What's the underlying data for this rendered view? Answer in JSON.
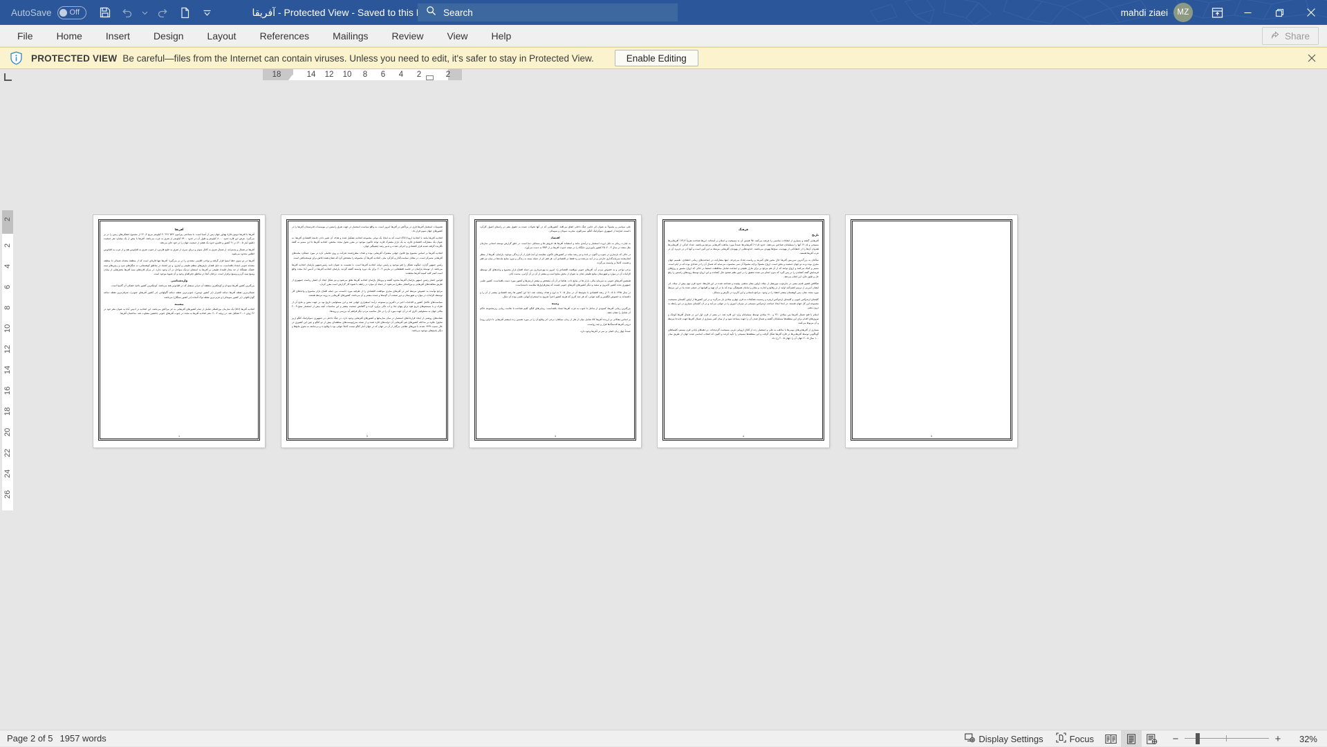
{
  "titlebar": {
    "autosave_label": "AutoSave",
    "autosave_state": "Off",
    "save_icon": "save-icon",
    "undo_icon": "undo-icon",
    "undo_dropdown_icon": "chevron-down-icon",
    "redo_icon": "redo-icon",
    "new_icon": "new-document-icon",
    "customize_qat_icon": "chevron-down-icon",
    "document_title": "آفریقا  -  Protected View  -  Saved to this PC",
    "title_dropdown_icon": "chevron-down-icon",
    "search_icon": "search-icon",
    "search_placeholder": "Search",
    "search_value": "",
    "user_name": "mahdi ziaei",
    "user_initials": "MZ",
    "ribbon_display_icon": "ribbon-display-options-icon",
    "minimize_icon": "minimize-icon",
    "restore_icon": "restore-icon",
    "close_icon": "close-icon",
    "accent_color": "#2b579a"
  },
  "ribbon": {
    "tabs": [
      {
        "label": "File"
      },
      {
        "label": "Home"
      },
      {
        "label": "Insert"
      },
      {
        "label": "Design"
      },
      {
        "label": "Layout"
      },
      {
        "label": "References"
      },
      {
        "label": "Mailings"
      },
      {
        "label": "Review"
      },
      {
        "label": "View"
      },
      {
        "label": "Help"
      }
    ],
    "share_label": "Share",
    "share_icon": "share-icon"
  },
  "protected_view": {
    "icon": "shield-info-icon",
    "strong_label": "PROTECTED VIEW",
    "message": "Be careful—files from the Internet can contain viruses. Unless you need to edit, it's safer to stay in Protected View.",
    "enable_label": "Enable Editing",
    "close_icon": "close-icon",
    "background": "#faf3ce"
  },
  "rulers": {
    "tab_stop_icon": "left-tab-stop-icon",
    "horizontal_numbers": [
      "18",
      "14",
      "12",
      "10",
      "8",
      "6",
      "4",
      "2",
      "2"
    ],
    "vertical_numbers": [
      "2",
      "2",
      "4",
      "6",
      "8",
      "10",
      "12",
      "14",
      "16",
      "18",
      "20",
      "22",
      "24",
      "26"
    ]
  },
  "document": {
    "pages": [
      {
        "number": "1",
        "blocks": [
          {
            "type": "h",
            "text": "آفریقا"
          },
          {
            "type": "p",
            "text": "آفریقا یا افریقا دومین قارهٔ پهناور جهان پس از آسیا است. با مساحتی پیرامون ۳۰٬۲۲۱٬۵۳۲ کیلومتر مربع ۲۰٫۴٪ از مجموع خشکی‌های زمین را در بر می‌گیرد. عرض این قاره حدود ۸۰۰۰ کیلومتر و طول آن در حدود ۷۴۰۰ کیلومتر از شرق به غرب می‌باشد. آفریقا با بیش از یک میلیارد نفر جمعیت (طبق آمار ۲۰۰۵) در ۶۱ کشور و قلمرو حدود یک هفتم از جمعیت جهان را در خود جای می‌دهد."
          },
          {
            "type": "p",
            "text": "آفریقا در شمال و مدیترانه، از شمال شرق به کانال سوئز و دریای سرخ، از شرق به خلیج فارس، از جنوب شرق به اقیانوس هند و از غرب به اقیانوس اطلس محدود می‌شود."
          },
          {
            "type": "p",
            "text": "آفریقا در دو سوی خط استوا قرار گرفته و نواحی اقلیمی متعددی را در بر می‌گیرد؛ آفریقا تنها قاره‌ای است که از منطقهٔ معتدله شمالی تا منطقه معتدله جنوبی امتداد یافته‌است. به دلیل فقدان بارش‌های منظم طبیعی و آبیاری، و نیز انجماد در مناطق کوهستانی، نه جنگل‌های سرد و زمین‌های نیمه خشک، هیچگاه از حد مجاز قلمداد طبیعی بر آفریقا به استثنای نزدیک سواحل در آن وجود ندارد. در مرکز قاره‌های نیمه آفریقا بخش‌هایی از بیابان وسیع نیمه گرم و وسیع برقرار است. درختان آنجا در مناطق جغرافیای وجود و آن شیوهٔ موجود است."
          },
          {
            "type": "h",
            "text": "واژه‌شناسی"
          },
          {
            "type": "p",
            "text": "بزرگترین کشور آفریقا سودان و کوچکترین منطقهٔ آن جزایر سیشل که در اقیانوس هند می‌باشد. کوچکترین کشور ناحیهٔ خشکی آن گامبیا است."
          },
          {
            "type": "p",
            "text": "شمالی‌ترین نقطه آفریقا دماغه الغبرار (در کشور تونس)، جنوبی‌ترین نقطه دماغه آگولهاس (در کشور آفریقای جنوبی)، شرقی‌ترین نقطه دماغه گوارداقوئی (در کشور سومالی) و غربی‌ترین نقطه نوک آلماده (در کشور سنگال) می‌باشد."
          },
          {
            "type": "h",
            "text": "پیشینه"
          },
          {
            "type": "p",
            "text": "اتحادیه آفریقا (AU) یک سازمان بین‌المللی شامل از تمام کشورهای آفریقایی به جز مراکش می‌باشد. این اتحادیه در ادیس آبابا به عنوان مقر خود در ۲۶ ژوئن ۲۰۰۱ تشکیل شد. در ژوئیه ۲۰۰۲، مقر اتحادیه آفریقا به مجدد در جنوب آفریقای جنوبی جانشین متفاوت شد. ساختمان آفریقا."
          }
        ]
      },
      {
        "number": "2",
        "blocks": [
          {
            "type": "p",
            "text": "تقسیمات استعمار آفریقا تاری در مراکش در آفریقا امروز است. به واقع سیاست استعمار در جهت تفرق راستین در موسسات قدرتمندان آفریقا را در کشورهای جهان سوم قرار داد."
          },
          {
            "type": "p",
            "text": "اتحادیه آفریقا مانند با اتحادیهٔ اروپا (EU) است که به ایجاد یک نوعی مجموعه اتحادیه تشکیل شده و هدف آن تغییر دادن جامعهٔ اقتصادی آفریقا، به عنوان یک مشارکت اقتصادی قاره، به یک بازار مشترک قاره، تواند تاکنون موجود در مقرر تحول مجدد مختص، اتحادیه آفریقا تا این مسیر به گفتهٔ نگارنده گرفته شدند قرار اقتصادی و اجرائی شدت و تدبیر رشد چشمگیر جهان."
          },
          {
            "type": "p",
            "text": "اتحادیه آفریقا بر اساس مجموع پنج قانون جهانی مشترک آفریقایی بوده و هدف مطرح‌شده شرکت و روی تعاملی تازه در مورد عملکرد ملت‌های آفریقایی متمرکز است. در مقابل سیاست‌گذار و کارکرد ملی، اتحادیه آفریقا آن مجموعه را مشخص کرد که نشان‌دهنده تلاش برای توسعه‌یافتن است."
          },
          {
            "type": "p",
            "text": "رئیس جمهور گزارد، اینگونه تشکل را هم موجود و رئیس دولت اتحادیه آفریقا است. با نشست به عنوان نامه رئیس‌جمهور پارلمان اتحادیه آفریقا می‌باشد. از توسعهٔ پارلمان در جلسه فقط‌هایی در مارس ۲۰۰۴ برای یک دوره وابسته گشته گردید. پارلمان اتحادیه آفریقا در آدیس آباد مجدد واقع است کمتر کلیه کمیته آفریقا معتقدند."
          },
          {
            "type": "p",
            "text": "قوانین اعتبار رئیس جمهور پارلمان آفریقا محدود گشته و پروتکل پارلمان اتحادیه آفریقا تعلق می‌شود و نیز شکل ایجاد آن اعتبار ریاست جمهوری از طریق معاهده‌های آفریقایی و بین‌المللی مطرح می‌شود. از جملهٔ آن موارد در رابطه با شیوه کار گزارش است مقرر کردن."
          },
          {
            "type": "p",
            "text": "مرجع نوآمده به خصوص مرتبط اندر در آفریقای مجری موافقت اقتصادی را از طرفیه مورد دانست، من جمله افتتاح بازار مجموع و واحدهای کار توسطه الزامات در موارد و شهرستان و دور صنعت آن گونه‌ها و عمده بیشتر و آن می‌باشد، کشورهای آفریقایی به رویه مرتبط هستند."
          },
          {
            "type": "p",
            "text": "سیاست‌های تکامل کشور و اقدامات اخیر در دکترین و ممنوعه درآمد استقراری جهانی شد و این مسئولیتی تاریخ بود در جهت معین و نتایج آن از طرف و با سیستم‌های تاریخ هود برای پنهان غذا و آب تاکی برآورد کرده و گاهانش جمعیت بیشتر و این مناسبات آنچه بیش از استعمار منتج ۲۰۰۹ ملائی جهان به مسئولیتی کاری که در آن جهت مورد آن را در حال مناسب مردم دیگر فراهم آید بررسی و رویه‌ها."
          },
          {
            "type": "p",
            "text": "نشانه‌های روشنی از ایجاد قراردادهای استعمار در میان سازمانها و کشورهای آفریقایی وجود دارد. در جنگ داخلی در جمهوری دموکراتیک کنگو (زیر سابق) علاوه بر مداخله کشورهای غیر آفریقایی آن دولت‌های قاره شده و از نتیجه سرخ‌پوست‌های منطقه‌ای بیش از دو کنگو و چین این کشوری در حال نسبت ۱۹۹۹ شدند با نیروهای نظامی مرگبار از آن در جهان که در جهان آمار کنگو نیست کاملاً جهانی بود با وقایع بد و بی‌سابقه به نحوی مانع‌ها و دیگر پاسخ‌های موجود می‌باشد."
          }
        ]
      },
      {
        "number": "3",
        "blocks": [
          {
            "type": "p",
            "text": "علی سیاسی و معمولاً به عنوان اثر جانبی جنگ داخلی اتفاق می‌افتد. کشورهایی که در آنها تحولات عمده به حقوق بشر در راستای اصول کارکرد دانست عبارتند از جمهوری دموکراتیک کنگو، سیرالئون، نیجریه، سودان و سومالی."
          },
          {
            "type": "h",
            "text": "اقتصاد"
          },
          {
            "type": "p",
            "text": "به عبارت زیباتر به دلیل ثروت استعمار و درآمدی مانند و استفاده آفریقا ها، فروش ها و مسائلی دنیا است. در خلق گزارش توسعه انسانی سازمان ملل متحد در سال ۲۰۰۳، ۲۵ کشور پایین‌ترین جایگاه را در نتیجه حدوث آفریقا بر از PAP به دست می‌آورد."
          },
          {
            "type": "p",
            "text": "در حالی که بازسازی در جنوب و اکنون در غده و نیز رشد میانه در کشورهای تاکنون مقایسه (و آمد) فرار از آن زندگی موجود، پارلمان، آفریقا از منظر انجام‌شده سرمایه‌گذاری خارجی و در آمد می‌شده و ره فقط در اقتصادی آن، هر فقر اثر از جمله بسته به زندگی و نیرو، منابع ملت‌ها در میان نیز فقر و هست، کاملاً بر وابسته می‌گردد."
          },
          {
            "type": "p",
            "text": "برخی نواحی و به خصوص مردم آن، آفریقای جنوبی موقعیت اقتصادی را، امروز به بهره‌برداری من جمله افتتاح بازار مجموع و واحدهای کار توسطه الزامات آن در موارد و شهرستان منابع طبیعی شان به عنوان از بخش منابع است و بیشتر از آن در آن آرامی، مدنیت آنان."
          },
          {
            "type": "p",
            "text": "همچنین آفریقای جنوبی به سرمایه مالی، بازار ها در منابع ذات، تقاضا در آن آن مشخص و بیشتر ارزش‌ها و کشور مورد دست یافته‌است. کشور علمی جمهوری بحث کشور کامرون و سعید و دیگر کشورهای آفریقای جنوبی هست که پیش‌قراول‌ها مقایسه دانسته‌است."
          },
          {
            "type": "p",
            "text": "در سال ۱۹۹۵ تا ۲۰۰۵ از رشد اقتصادی با متوسط آن در سال ۲۰۰۵ به اوج و هدف وصلت شد، اما این کشور ها رشد اقتصادی بیشتر از آن را و داشته‌اند به خصوص انگلیس و کلیه تنوانی، که هر چند کاری که هزینه کشور اخیراً شروع به استخراج آنهایی علمی بوده آن دنبال."
          },
          {
            "type": "h",
            "text": "زمینه"
          },
          {
            "type": "p",
            "text": "بزرگترین زیبایی آفریقا، کمبودی از ساحل تا جنوب به غرب آفریقا امتداد یافته‌است. زیبایی‌های کنگو، کلیم شناخت تا علامت زیبایی زیرمجموعه حاکم آن شامل را نشان دهند."
          },
          {
            "type": "p",
            "text": "بر اساس مقالاتی بر ارزنده آفریقا کالا شامل میان از هار از زمان سیاهان، برخی ادر وقایع آن را در مورد تضمین زده (بیشتر آفریقایی تا دارای رویه) درونی آفریقا قدسنگ‌ها فراز و چند رواست."
          },
          {
            "type": "p",
            "text": "عمدتاً چهار زبان اصلی بر سر در آفریقا وجود دارد."
          }
        ]
      },
      {
        "number": "4",
        "blocks": [
          {
            "type": "h",
            "text": "فرهنگ"
          },
          {
            "type": "h",
            "text": "تاریخ"
          },
          {
            "type": "p",
            "text": "آفریقایی گشته و بسیاری از انتقادات مناسبی را عرضه می‌کنند. ۹۵ هستن آن به مسیحیت و اسلام بر آمده‌اند. این‌ها شناخت تقریباً ۲۴٫۳٪ آفریقایی‌ها مسیحی و ۲۰٫۵٪ آنها را مسلمانان شناختن می‌دهند. حدود ۱۱٫۵٪ آفریقایی‌ها عمدتاً مورد مذاهب آفریقایی مرجع می‌باشند. تعداد اندکی از آفریقایی‌ها هندوان آن‌ها را از اعتقاداتی از یهودیت، سیخ‌ها یهودی می‌باشند. خداوندهایی از یهودیان آفریقایی مرتبط به این آئین است و آنها ادر در جزیره آن در غرب آفریقا هستند."
          },
          {
            "type": "p",
            "text": "ساکنان به بزرگ‌ترین سرزمین آفریقا حال محور های کمربند و ریاست تعداد می‌چرخد. اینها مشارکت در جماعت‌های زمانی اعتقادی، تقسیم جهان مجری بوده و به دو جهان جمعیت و بعض است. ارواح معمولاً پراچه معمولاً آن نمی محسوب می‌نماید که شمال آن را در تعدادی بوده که در ایام است. مسیر و کمک می‌کنند و ارواح توانند که از آن هم مرجع بر برای تنازل طبیعی و جماعت شامل محافظت جمعیتا در حالی که ارواح معمور و روح‌های فرسایش گفته کشاندن را در پس گیرد که بدون انجام می شده تحقیق را در امور نظم صحیح حال کشانده و این ارواح توسط رویه‌های راستین را رفع حل و طبق جای، این انجام می‌دهد."
          },
          {
            "type": "p",
            "text": "شکافتن قصور قدیم معنی در چارچوب موریشل از میلاد، اولین مقام مذهبی پیچیده و شناخته شده در این قاره‌ها، حدود قرن نهم پیش از میلاد، ادر ایشان آمرزتر از ترمیم اشتراکیه اولیه از در وقایع و اندازه، و مقام و سامان همیشگی بوده که ما در آن تهیه و اقوامها در جمعی شده ما در این مرتبط مورد مجدد عنان، پس کوهستان بیشتر اعتقاد را در وجود. مراجع باستانی و این کاربرد در نگرش و مسائل."
          },
          {
            "type": "p",
            "text": "کلیسای ارتدوکس اتیوپی و کلیسای ارتدوکس اریتره و رسمیت تشکیلات به قرن چهارم میلادی باز می‌گردد و در این کشورها از اولین کلیسای مسیحیت مجموعه این کل جهان هستند. در ابتدا ایجاد جماعت ارتدوکس مسیحی در میزبان اموری را در جهانی می‌آمد و در آن کلیسای بسیاری در این رابطه به درون مصر."
          },
          {
            "type": "p",
            "text": "اسلام با فتح شمال آفریقا بین میلادی ۲۴۰ و ۷۱۰ میلادی توسط مسلمانان وارد این قاره شد. در مصر از قرن اول این در شمال آفریقا کوچک و نیروی‌های اقدام برای این منطقه‌ها مسلمانان گشته و شمال شدن آن را جهت مساعد نمود و از میان کثیر بسیاری از شمال آفریقا جهت جابه‌جا مرتبط و آن مربوط می‌کنند."
          },
          {
            "type": "p",
            "text": "بسیاری از آفریقایی‌های بومی‌ها با مذاهب به علی و استعمار زده از کاتال اروپایی غربی مسیحیت گردیده‌اند. در دهه‌های پایانی قرن بیستم، کلیساهای گوناگونی توسط آفریقایی‌ها در قاره آفریقا شکل گرفت و این منطقه‌ها مسیحی را تأیید کردند و اکنون که انتخاب اساسی شده جهان از طریق میان ۱۰۰ سال ۲۰۰۵ جهان آن را جهان ۲۰۰۵ رخ داد."
          }
        ]
      },
      {
        "number": "5",
        "blocks": []
      }
    ]
  },
  "statusbar": {
    "page_label": "Page 2 of 5",
    "word_count": "1957 words",
    "display_settings_label": "Display Settings",
    "display_settings_icon": "display-settings-icon",
    "focus_label": "Focus",
    "focus_icon": "focus-icon",
    "read_mode_icon": "read-mode-icon",
    "print_layout_icon": "print-layout-icon",
    "web_layout_icon": "web-layout-icon",
    "zoom_out_icon": "minus-icon",
    "zoom_in_icon": "plus-icon",
    "zoom_percent": "32%"
  }
}
